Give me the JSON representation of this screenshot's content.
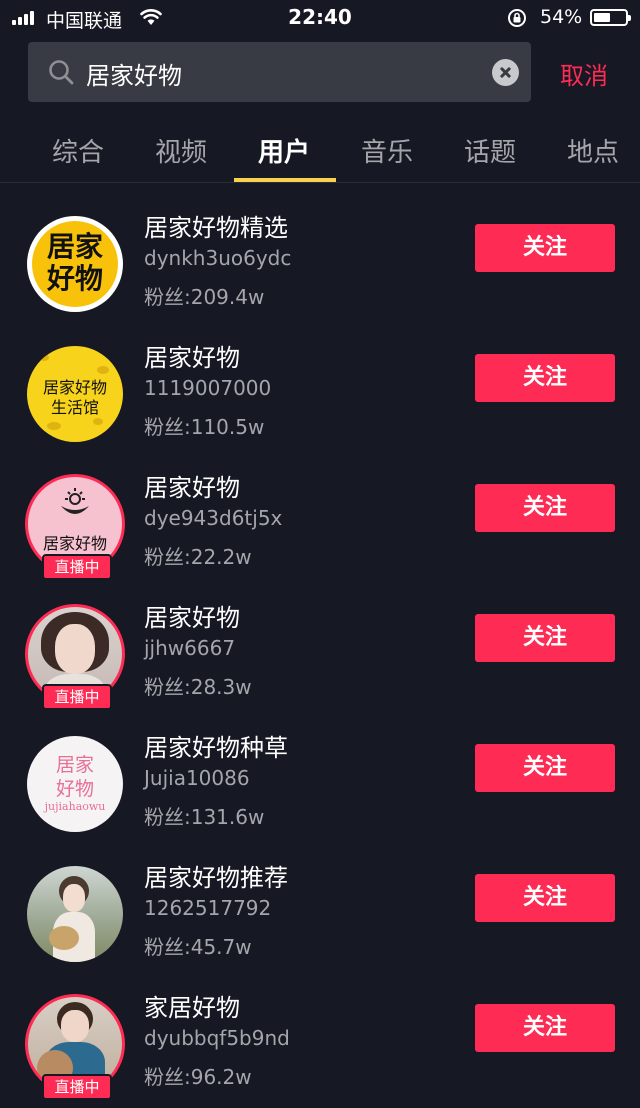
{
  "status_bar": {
    "carrier": "中国联通",
    "time": "22:40",
    "battery_pct": "54%",
    "battery_level": 0.54
  },
  "search": {
    "query": "居家好物",
    "cancel_label": "取消"
  },
  "tabs": [
    {
      "label": "综合",
      "active": false
    },
    {
      "label": "视频",
      "active": false
    },
    {
      "label": "用户",
      "active": true
    },
    {
      "label": "音乐",
      "active": false
    },
    {
      "label": "话题",
      "active": false
    },
    {
      "label": "地点",
      "active": false
    }
  ],
  "users": [
    {
      "name": "居家好物精选",
      "id": "dynkh3uo6ydc",
      "fans": "粉丝:209.4w",
      "follow": "关注",
      "avatar_text_1": "居家",
      "avatar_text_2": "好物"
    },
    {
      "name": "居家好物",
      "id": "1119007000",
      "fans": "粉丝:110.5w",
      "follow": "关注",
      "avatar_text_1": "居家好物",
      "avatar_text_2": "生活馆"
    },
    {
      "name": "居家好物",
      "id": "dye943d6tj5x",
      "fans": "粉丝:22.2w",
      "follow": "关注",
      "avatar_text_1": "居家好物",
      "live": "直播中"
    },
    {
      "name": "居家好物",
      "id": "jjhw6667",
      "fans": "粉丝:28.3w",
      "follow": "关注",
      "live": "直播中"
    },
    {
      "name": "居家好物种草",
      "id": "Jujia10086",
      "fans": "粉丝:131.6w",
      "follow": "关注",
      "avatar_text_1": "居家",
      "avatar_text_2": "好物",
      "avatar_text_3": "jujiahaowu"
    },
    {
      "name": "居家好物推荐",
      "id": "1262517792",
      "fans": "粉丝:45.7w",
      "follow": "关注"
    },
    {
      "name": "家居好物",
      "id": "dyubbqf5b9nd",
      "fans": "粉丝:96.2w",
      "follow": "关注",
      "live": "直播中"
    }
  ],
  "colors": {
    "background": "#161823",
    "accent": "#fe2c55",
    "tab_indicator": "#f7d24d",
    "secondary_text": "#a4a6ab"
  }
}
